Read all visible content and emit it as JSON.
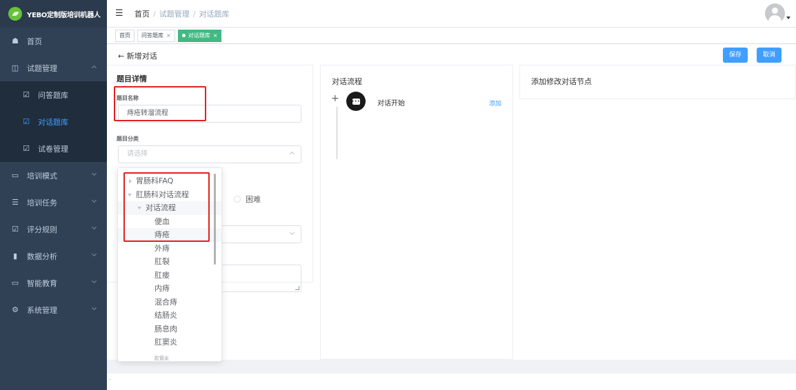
{
  "brand": {
    "name": "YEBO定制版培训机器人"
  },
  "sidebar": {
    "items": [
      {
        "label": "首页",
        "icon": "dashboard-icon",
        "glyph": "☗"
      },
      {
        "label": "试题管理",
        "icon": "book-icon",
        "glyph": "◫",
        "expanded": true,
        "children": [
          {
            "label": "问答题库",
            "icon": "edit-icon",
            "glyph": "☑"
          },
          {
            "label": "对话题库",
            "icon": "edit-icon",
            "glyph": "☑",
            "active": true
          },
          {
            "label": "试卷管理",
            "icon": "edit-icon",
            "glyph": "☑"
          }
        ]
      },
      {
        "label": "培训模式",
        "icon": "monitor-icon",
        "glyph": "▭"
      },
      {
        "label": "培训任务",
        "icon": "list-icon",
        "glyph": "☰"
      },
      {
        "label": "评分规则",
        "icon": "edit-icon",
        "glyph": "☑"
      },
      {
        "label": "数据分析",
        "icon": "bar-chart-icon",
        "glyph": "▮"
      },
      {
        "label": "智能教育",
        "icon": "screen-icon",
        "glyph": "▭"
      },
      {
        "label": "系统管理",
        "icon": "gear-icon",
        "glyph": "⚙"
      }
    ]
  },
  "breadcrumb": {
    "home": "首页",
    "sep": "/",
    "level1": "试题管理",
    "level2": "对话题库"
  },
  "tags": [
    {
      "label": "首页"
    },
    {
      "label": "问答题库",
      "close": "×"
    },
    {
      "label": "对话题库",
      "close": "×",
      "active": true
    }
  ],
  "page": {
    "back_label": "← 新增对话",
    "save_label": "保存",
    "cancel_label": "取消"
  },
  "detail": {
    "title": "题目详情",
    "name_label": "题目名称",
    "name_value": "痔疮转溜流程",
    "category_label": "题目分类",
    "category_placeholder": "请选择",
    "difficulty_hard": "困难"
  },
  "flow": {
    "title": "对话流程",
    "plus": "+",
    "start_label": "对话开始",
    "add_label": "添加"
  },
  "node_panel": {
    "title": "添加修改对话节点"
  },
  "tree": [
    {
      "label": "胃肠科FAQ",
      "level": 0,
      "arrow": "collapsed"
    },
    {
      "label": "肛肠科对话流程",
      "level": 0,
      "arrow": "expanded"
    },
    {
      "label": "对话流程",
      "level": 1,
      "arrow": "expanded",
      "highlight": true
    },
    {
      "label": "便血",
      "level": 2
    },
    {
      "label": "痔疮",
      "level": 2,
      "highlight": true
    },
    {
      "label": "外痔",
      "level": 2
    },
    {
      "label": "肛裂",
      "level": 2
    },
    {
      "label": "肛瘘",
      "level": 2
    },
    {
      "label": "内痔",
      "level": 2
    },
    {
      "label": "混合痔",
      "level": 2
    },
    {
      "label": "结肠炎",
      "level": 2
    },
    {
      "label": "肠息肉",
      "level": 2
    },
    {
      "label": "肛窦炎",
      "level": 2
    }
  ],
  "tree_cut_text": "肛管炎",
  "footer": {
    "text": "-"
  },
  "colors": {
    "sidebar": "#304156",
    "accent": "#409eff",
    "tag_active": "#42b983",
    "annotation": "#e02020"
  }
}
